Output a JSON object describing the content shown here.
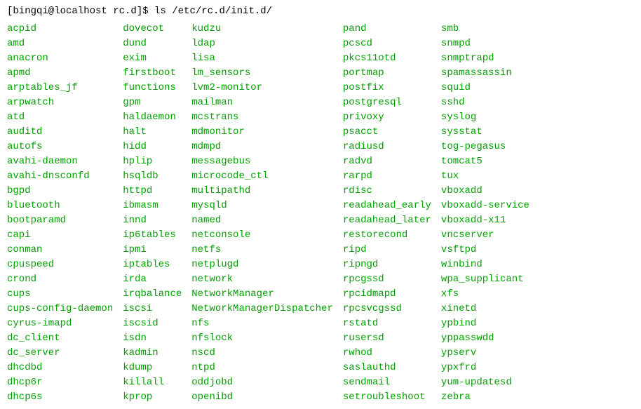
{
  "prompt": {
    "user_host": "[bingqi@localhost rc.d]$ ",
    "command": "ls /etc/rc.d/init.d/"
  },
  "columns": [
    [
      "acpid",
      "amd",
      "anacron",
      "apmd",
      "arptables_jf",
      "arpwatch",
      "atd",
      "auditd",
      "autofs",
      "avahi-daemon",
      "avahi-dnsconfd",
      "bgpd",
      "bluetooth",
      "bootparamd",
      "capi",
      "conman",
      "cpuspeed",
      "crond",
      "cups",
      "cups-config-daemon",
      "cyrus-imapd",
      "dc_client",
      "dc_server",
      "dhcdbd",
      "dhcp6r",
      "dhcp6s"
    ],
    [
      "dovecot",
      "dund",
      "exim",
      "firstboot",
      "functions",
      "gpm",
      "haldaemon",
      "halt",
      "hidd",
      "hplip",
      "hsqldb",
      "httpd",
      "ibmasm",
      "innd",
      "ip6tables",
      "ipmi",
      "iptables",
      "irda",
      "irqbalance",
      "iscsi",
      "iscsid",
      "isdn",
      "kadmin",
      "kdump",
      "killall",
      "kprop"
    ],
    [
      "kudzu",
      "ldap",
      "lisa",
      "lm_sensors",
      "lvm2-monitor",
      "mailman",
      "mcstrans",
      "mdmonitor",
      "mdmpd",
      "messagebus",
      "microcode_ctl",
      "multipathd",
      "mysqld",
      "named",
      "netconsole",
      "netfs",
      "netplugd",
      "network",
      "NetworkManager",
      "NetworkManagerDispatcher",
      "nfs",
      "nfslock",
      "nscd",
      "ntpd",
      "oddjobd",
      "openibd"
    ],
    [
      "pand",
      "pcscd",
      "pkcs11otd",
      "portmap",
      "postfix",
      "postgresql",
      "privoxy",
      "psacct",
      "radiusd",
      "radvd",
      "rarpd",
      "rdisc",
      "readahead_early",
      "readahead_later",
      "restorecond",
      "ripd",
      "ripngd",
      "rpcgssd",
      "rpcidmapd",
      "rpcsvcgssd",
      "rstatd",
      "rusersd",
      "rwhod",
      "saslauthd",
      "sendmail",
      "setroubleshoot"
    ],
    [
      "smb",
      "snmpd",
      "snmptrapd",
      "spamassassin",
      "squid",
      "sshd",
      "syslog",
      "sysstat",
      "tog-pegasus",
      "tomcat5",
      "tux",
      "vboxadd",
      "vboxadd-service",
      "vboxadd-x11",
      "vncserver",
      "vsftpd",
      "winbind",
      "wpa_supplicant",
      "xfs",
      "xinetd",
      "ypbind",
      "yppasswdd",
      "ypserv",
      "ypxfrd",
      "yum-updatesd",
      "zebra"
    ]
  ]
}
